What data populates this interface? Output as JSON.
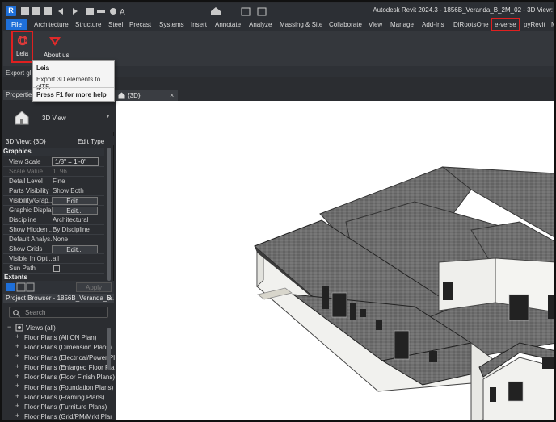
{
  "titlebar": {
    "app_logo": "R",
    "title": "Autodesk Revit 2024.3 - 1856B_Veranda_B_2M_02 - 3D View:",
    "quick_access_icons": [
      "open-icon",
      "save-icon",
      "sync-icon",
      "undo-icon",
      "redo-icon",
      "print-icon",
      "measure-icon",
      "tag-icon",
      "text-icon",
      "3d-house-icon",
      "switch-windows-icon",
      "close-hidden-icon"
    ]
  },
  "menu": {
    "tabs": [
      "File",
      "Architecture",
      "Structure",
      "Steel",
      "Precast",
      "Systems",
      "Insert",
      "Annotate",
      "Analyze",
      "Massing & Site",
      "Collaborate",
      "View",
      "Manage",
      "Add-Ins",
      "DiRootsOne",
      "e-verse",
      "pyRevit",
      "M"
    ],
    "active_tab": "e-verse"
  },
  "ribbon": {
    "leia_label": "Leia",
    "about_label": "About us",
    "panel_label": "Export gl"
  },
  "tooltip": {
    "title": "Leia",
    "description": "Export 3D elements to glTF.",
    "help": "Press F1 for more help"
  },
  "properties": {
    "header": "Properties",
    "view_type": "3D View",
    "selector_label": "3D View: {3D}",
    "edit_type": "Edit Type",
    "group": "Graphics",
    "rows": [
      {
        "name": "View Scale",
        "value": "1/8\" = 1'-0\""
      },
      {
        "name": "Scale Value",
        "value": "1:  96"
      },
      {
        "name": "Detail Level",
        "value": "Fine"
      },
      {
        "name": "Parts Visibility",
        "value": "Show Both"
      },
      {
        "name": "Visibility/Grap...",
        "value": "Edit..."
      },
      {
        "name": "Graphic Displa...",
        "value": "Edit..."
      },
      {
        "name": "Discipline",
        "value": "Architectural"
      },
      {
        "name": "Show Hidden ...",
        "value": "By Discipline"
      },
      {
        "name": "Default Analys...",
        "value": "None"
      },
      {
        "name": "Show Grids",
        "value": "Edit..."
      },
      {
        "name": "Visible In Opti...",
        "value": "all"
      },
      {
        "name": "Sun Path",
        "value": ""
      },
      {
        "name": "Extents",
        "value": ""
      }
    ],
    "apply": "Apply"
  },
  "project_browser": {
    "header": "Project Browser - 1856B_Veranda_B...",
    "search_placeholder": "Search",
    "root": "Views (all)",
    "items": [
      "Floor Plans (All ON Plan)",
      "Floor Plans (Dimension Plans)",
      "Floor Plans (Electrical/Power Pl",
      "Floor Plans (Enlarged Floor Pla",
      "Floor Plans (Floor Finish Plans)",
      "Floor Plans (Foundation Plans)",
      "Floor Plans (Framing Plans)",
      "Floor Plans (Furniture Plans)",
      "Floor Plans (Grid/PM/Mrkt Plar"
    ]
  },
  "view_tab": {
    "label": "{3D}",
    "close": "×"
  },
  "colors": {
    "accent_blue": "#1e6fd9",
    "highlight_red": "#e02020",
    "panel_dark": "#2b2d31",
    "roof_gray": "#707070",
    "wall_white": "#f2f2f0"
  }
}
